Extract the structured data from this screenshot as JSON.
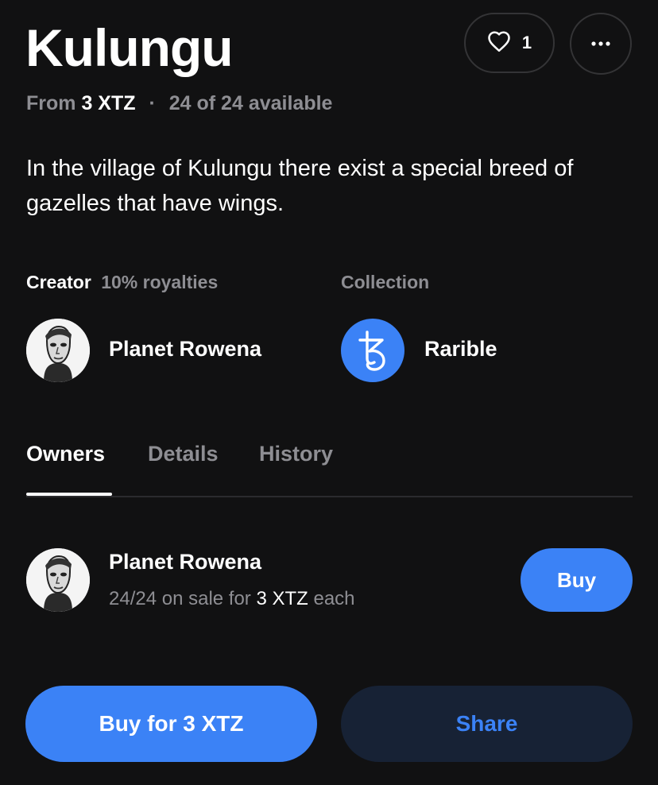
{
  "item": {
    "title": "Kulungu",
    "likes": "1",
    "from_label": "From",
    "price": "3 XTZ",
    "separator": "·",
    "availability": "24 of 24 available",
    "description": "In the village of Kulungu there exist a special breed of gazelles that have wings."
  },
  "creator": {
    "label": "Creator",
    "royalties": "10% royalties",
    "name": "Planet Rowena"
  },
  "collection": {
    "label": "Collection",
    "name": "Rarible"
  },
  "tabs": [
    {
      "label": "Owners",
      "active": true
    },
    {
      "label": "Details",
      "active": false
    },
    {
      "label": "History",
      "active": false
    }
  ],
  "owner": {
    "name": "Planet Rowena",
    "sale_prefix": "24/24 on sale for",
    "sale_price": "3 XTZ",
    "sale_suffix": "each",
    "buy_label": "Buy"
  },
  "actions": {
    "buy_label": "Buy for 3 XTZ",
    "share_label": "Share"
  },
  "colors": {
    "background": "#111112",
    "accent": "#3b82f6",
    "muted_text": "#8e8e93",
    "share_bg": "#172235"
  },
  "icons": {
    "like": "heart-icon",
    "more": "ellipsis-icon",
    "collection": "tezos-logo-icon"
  }
}
